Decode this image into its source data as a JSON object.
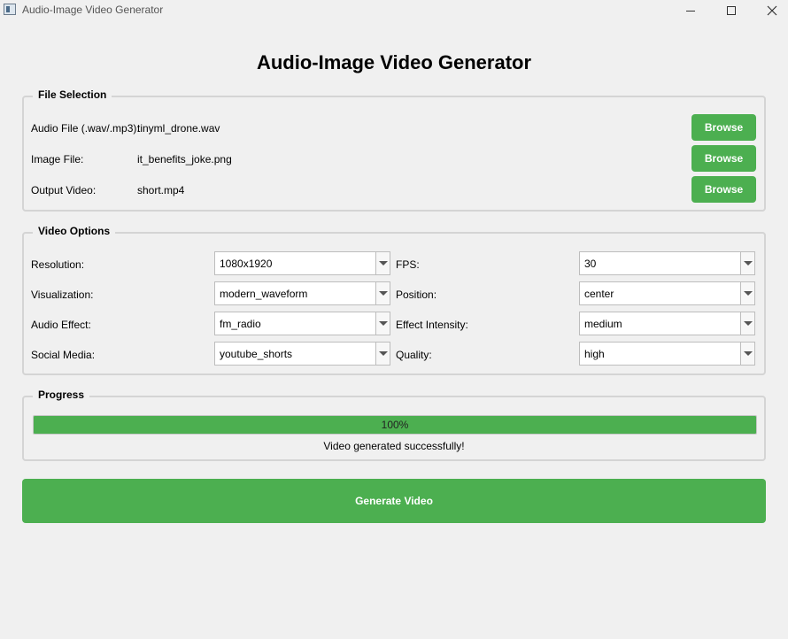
{
  "window": {
    "title": "Audio-Image Video Generator"
  },
  "app": {
    "heading": "Audio-Image Video Generator"
  },
  "file_selection": {
    "title": "File Selection",
    "rows": [
      {
        "label": "Audio File (.wav/.mp3):",
        "value": "tinyml_drone.wav",
        "button": "Browse"
      },
      {
        "label": "Image File:",
        "value": "it_benefits_joke.png",
        "button": "Browse"
      },
      {
        "label": "Output Video:",
        "value": "short.mp4",
        "button": "Browse"
      }
    ]
  },
  "video_options": {
    "title": "Video Options",
    "fields": {
      "resolution": {
        "label": "Resolution:",
        "value": "1080x1920"
      },
      "fps": {
        "label": "FPS:",
        "value": "30"
      },
      "visualization": {
        "label": "Visualization:",
        "value": "modern_waveform"
      },
      "position": {
        "label": "Position:",
        "value": "center"
      },
      "audio_effect": {
        "label": "Audio Effect:",
        "value": "fm_radio"
      },
      "effect_intensity": {
        "label": "Effect Intensity:",
        "value": "medium"
      },
      "social_media": {
        "label": "Social Media:",
        "value": "youtube_shorts"
      },
      "quality": {
        "label": "Quality:",
        "value": "high"
      }
    }
  },
  "progress": {
    "title": "Progress",
    "percent": 100,
    "text": "100%",
    "status": "Video generated successfully!"
  },
  "actions": {
    "generate_label": "Generate Video"
  },
  "colors": {
    "accent": "#4caf50",
    "background": "#f0f0f0"
  },
  "icons": {
    "app": "app-window-icon",
    "minimize": "minimize-icon",
    "maximize": "maximize-icon",
    "close": "close-icon",
    "dropdown": "chevron-down-icon"
  }
}
